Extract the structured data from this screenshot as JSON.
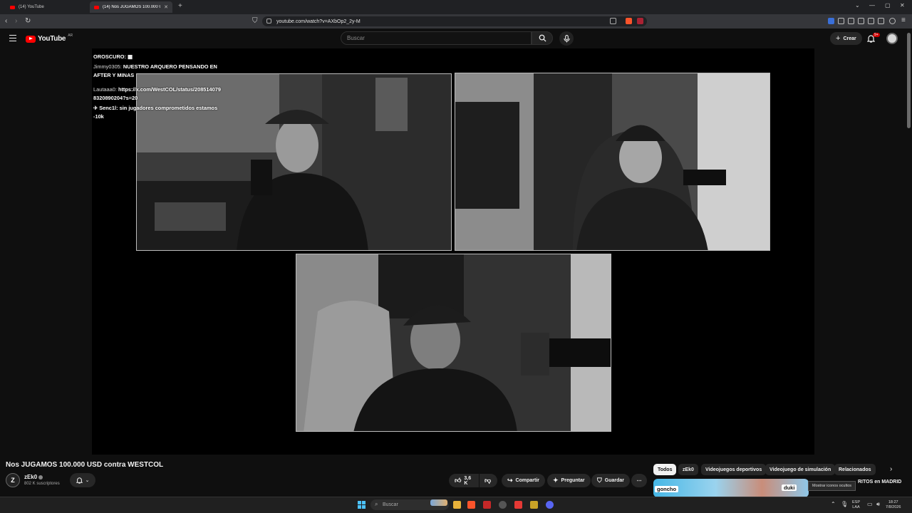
{
  "browser": {
    "tabs": [
      {
        "title": "(14) YouTube",
        "active": false
      },
      {
        "title": "(14) Nos JUGAMOS 100.000 US",
        "active": true
      }
    ],
    "url": "youtube.com/watch?v=AXbOp2_2y-M"
  },
  "masthead": {
    "logo_text": "YouTube",
    "country": "AR",
    "search_placeholder": "Buscar",
    "create_label": "Crear",
    "notifications_badge": "9+"
  },
  "stream": {
    "chat": [
      {
        "user": "OROSCURO: ",
        "text": "▦"
      },
      {
        "user": "Jimmy0305: ",
        "text": "NUESTRO ARQUERO PENSANDO EN AFTER Y MINAS"
      },
      {
        "user": "Lautaaa0: ",
        "text": "https://x.com/WestCOL/status/2085140798320890204?s=20"
      },
      {
        "user": "✈ Senc1l: ",
        "text": "sin jugadores comprometidos estamos -10k"
      }
    ]
  },
  "video": {
    "title": "Nos JUGAMOS 100.000 USD contra WESTCOL",
    "channel": {
      "avatar_letter": "Z",
      "name": "zEk0",
      "subscribers": "802 K suscriptores"
    },
    "likes": "3,6 K",
    "actions": {
      "share": "Compartir",
      "ask": "Preguntar",
      "save": "Guardar"
    }
  },
  "chips": [
    "Todos",
    "zEk0",
    "Videojuegos deportivos",
    "Videojuego de simulación",
    "Relacionados"
  ],
  "recommended": {
    "thumb_tags": [
      "goncho",
      "duki"
    ],
    "title_fragment": "RITOS en MADRID"
  },
  "tooltip": "Mostrar iconos ocultos",
  "taskbar": {
    "search_placeholder": "Buscar",
    "lang_top": "ESP",
    "lang_bottom": "LAA",
    "time": "18:27",
    "date": "7/8/2026"
  },
  "colors": {
    "youtube_red": "#ff0000",
    "background": "#0f0f0f",
    "chip_active": "#f1f1f1",
    "start_blue": "#4cc2ff"
  }
}
